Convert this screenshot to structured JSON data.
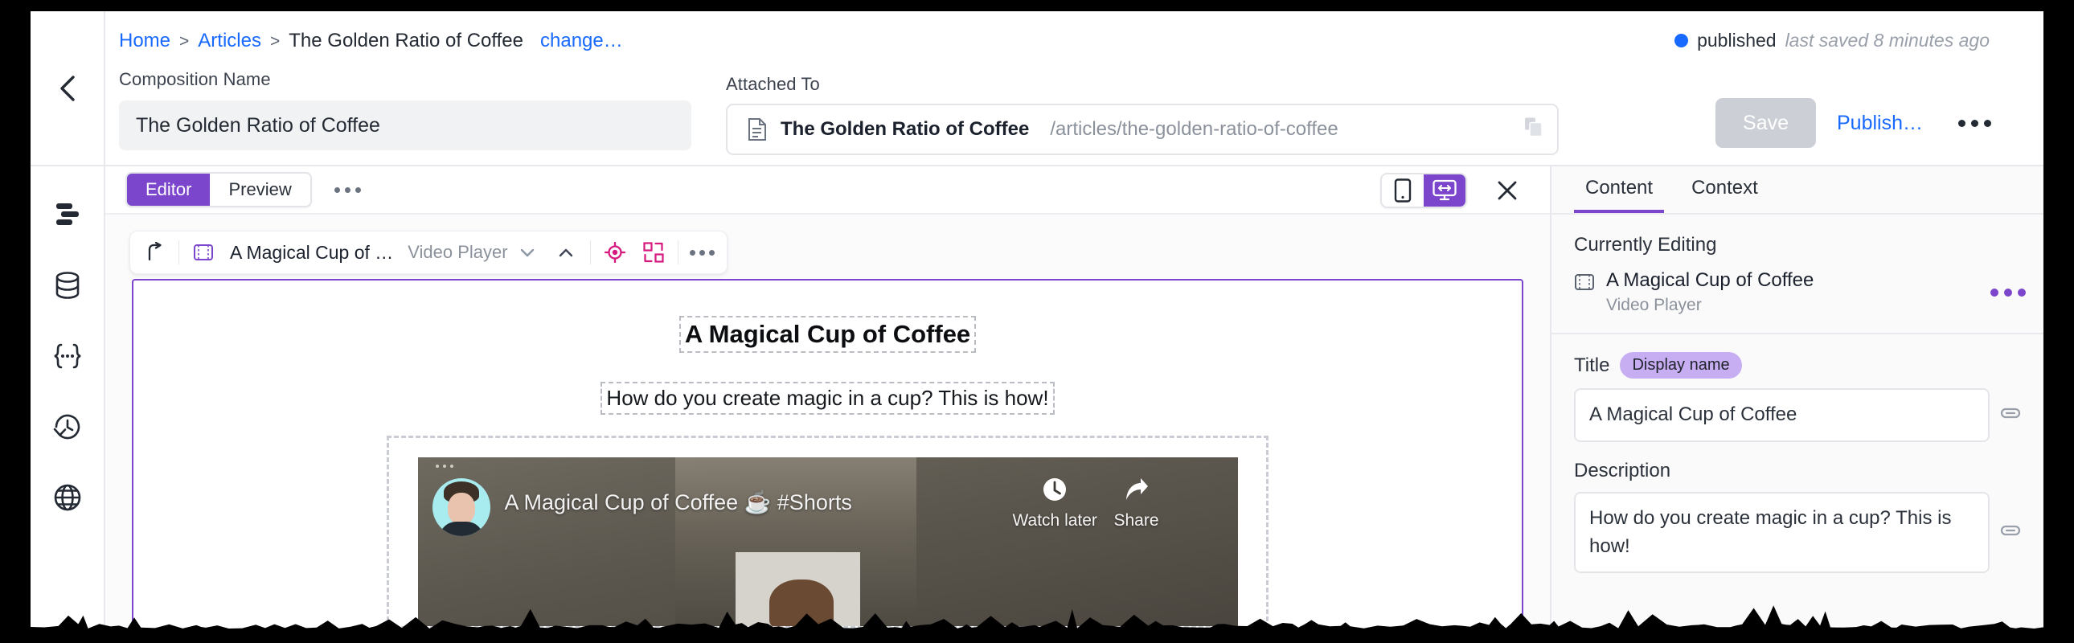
{
  "header": {
    "breadcrumb": {
      "home": "Home",
      "sep": ">",
      "articles": "Articles",
      "current": "The Golden Ratio of Coffee",
      "change": "change…"
    },
    "composition": {
      "label": "Composition Name",
      "value": "The Golden Ratio of Coffee"
    },
    "attached": {
      "label": "Attached To",
      "title": "The Golden Ratio of Coffee",
      "path": "/articles/the-golden-ratio-of-coffee"
    },
    "status": {
      "state": "published",
      "saved": "last saved 8 minutes ago",
      "dot_color": "#1769ff"
    },
    "actions": {
      "save": "Save",
      "publish": "Publish…",
      "more": "more-options"
    }
  },
  "rail": {
    "items": [
      {
        "name": "layers-icon"
      },
      {
        "name": "database-icon"
      },
      {
        "name": "code-braces-icon"
      },
      {
        "name": "history-icon"
      },
      {
        "name": "globe-icon"
      }
    ]
  },
  "editor": {
    "modes": [
      {
        "label": "Editor",
        "active": true
      },
      {
        "label": "Preview",
        "active": false
      }
    ],
    "viewports": [
      {
        "name": "mobile-icon",
        "active": false
      },
      {
        "name": "responsive-desktop-icon",
        "active": true
      }
    ],
    "close": "close-editor",
    "component_bar": {
      "name": "A Magical Cup of …",
      "type": "Video Player"
    },
    "accent": "#7b46cc",
    "component_accent": "#d6197d"
  },
  "canvas": {
    "title": "A Magical Cup of Coffee",
    "subtitle": "How do you create magic in a cup? This is how!",
    "video": {
      "title": "A Magical Cup of Coffee ☕ #Shorts",
      "watch_later": "Watch later",
      "share": "Share"
    }
  },
  "right_panel": {
    "tabs": [
      {
        "label": "Content",
        "active": true
      },
      {
        "label": "Context",
        "active": false
      }
    ],
    "currently_editing_label": "Currently Editing",
    "item": {
      "name": "A Magical Cup of Coffee",
      "type": "Video Player"
    },
    "fields": [
      {
        "label": "Title",
        "badge": "Display name",
        "value": "A Magical Cup of Coffee"
      },
      {
        "label": "Description",
        "badge": "",
        "value": "How do you create magic in a cup? This is how!"
      }
    ]
  }
}
